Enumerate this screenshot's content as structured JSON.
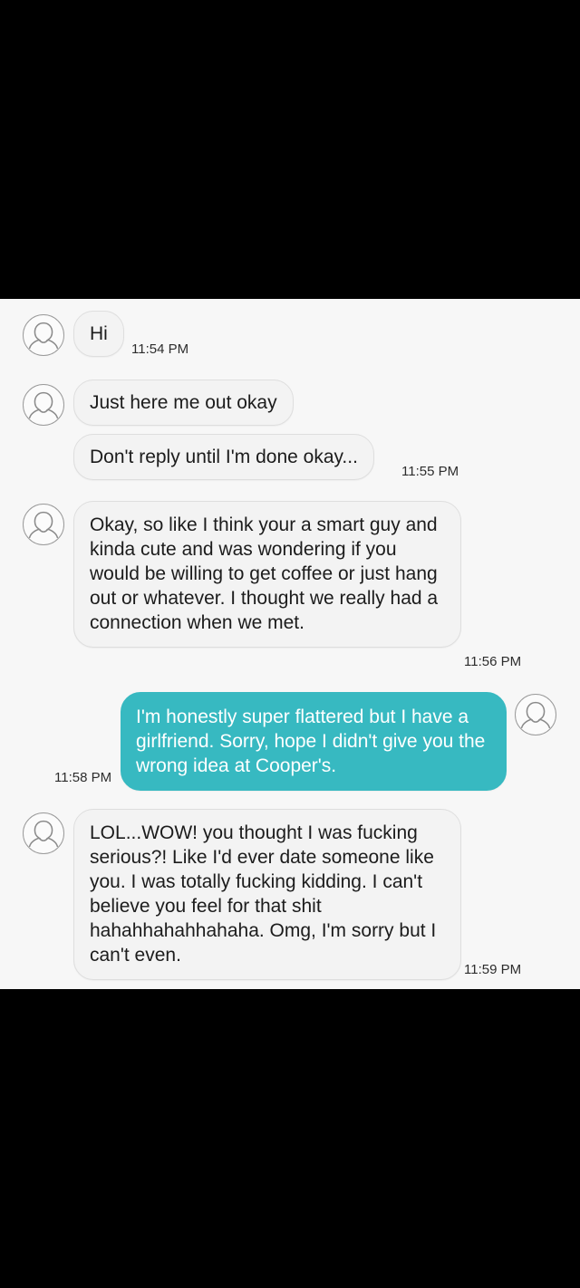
{
  "colors": {
    "chat_background": "#f7f7f7",
    "incoming_bubble": "#f3f3f3",
    "outgoing_bubble": "#37b9c1",
    "letterbox": "#000000"
  },
  "icons": {
    "avatar": "person-outline-icon"
  },
  "messages": [
    {
      "sender": "them",
      "text": "Hi",
      "time": "11:54 PM"
    },
    {
      "sender": "them",
      "text": "Just here me out okay",
      "time": ""
    },
    {
      "sender": "them",
      "text": "Don't reply until I'm done okay...",
      "time": "11:55 PM"
    },
    {
      "sender": "them",
      "text": "Okay, so like I think your a smart guy and kinda cute and was wondering if you would be willing to get coffee or just hang out or whatever. I thought we really had a connection when we met.",
      "time": "11:56 PM"
    },
    {
      "sender": "me",
      "text": "I'm honestly super flattered but I have a girlfriend. Sorry, hope I didn't give you the wrong idea at Cooper's.",
      "time": "11:58 PM"
    },
    {
      "sender": "them",
      "text": "LOL...WOW! you thought I was fucking serious?! Like I'd ever date someone like you. I was totally fucking kidding. I can't believe you feel for that shit hahahhahahhahaha. Omg, I'm sorry but I can't even.",
      "time": "11:59 PM"
    }
  ]
}
